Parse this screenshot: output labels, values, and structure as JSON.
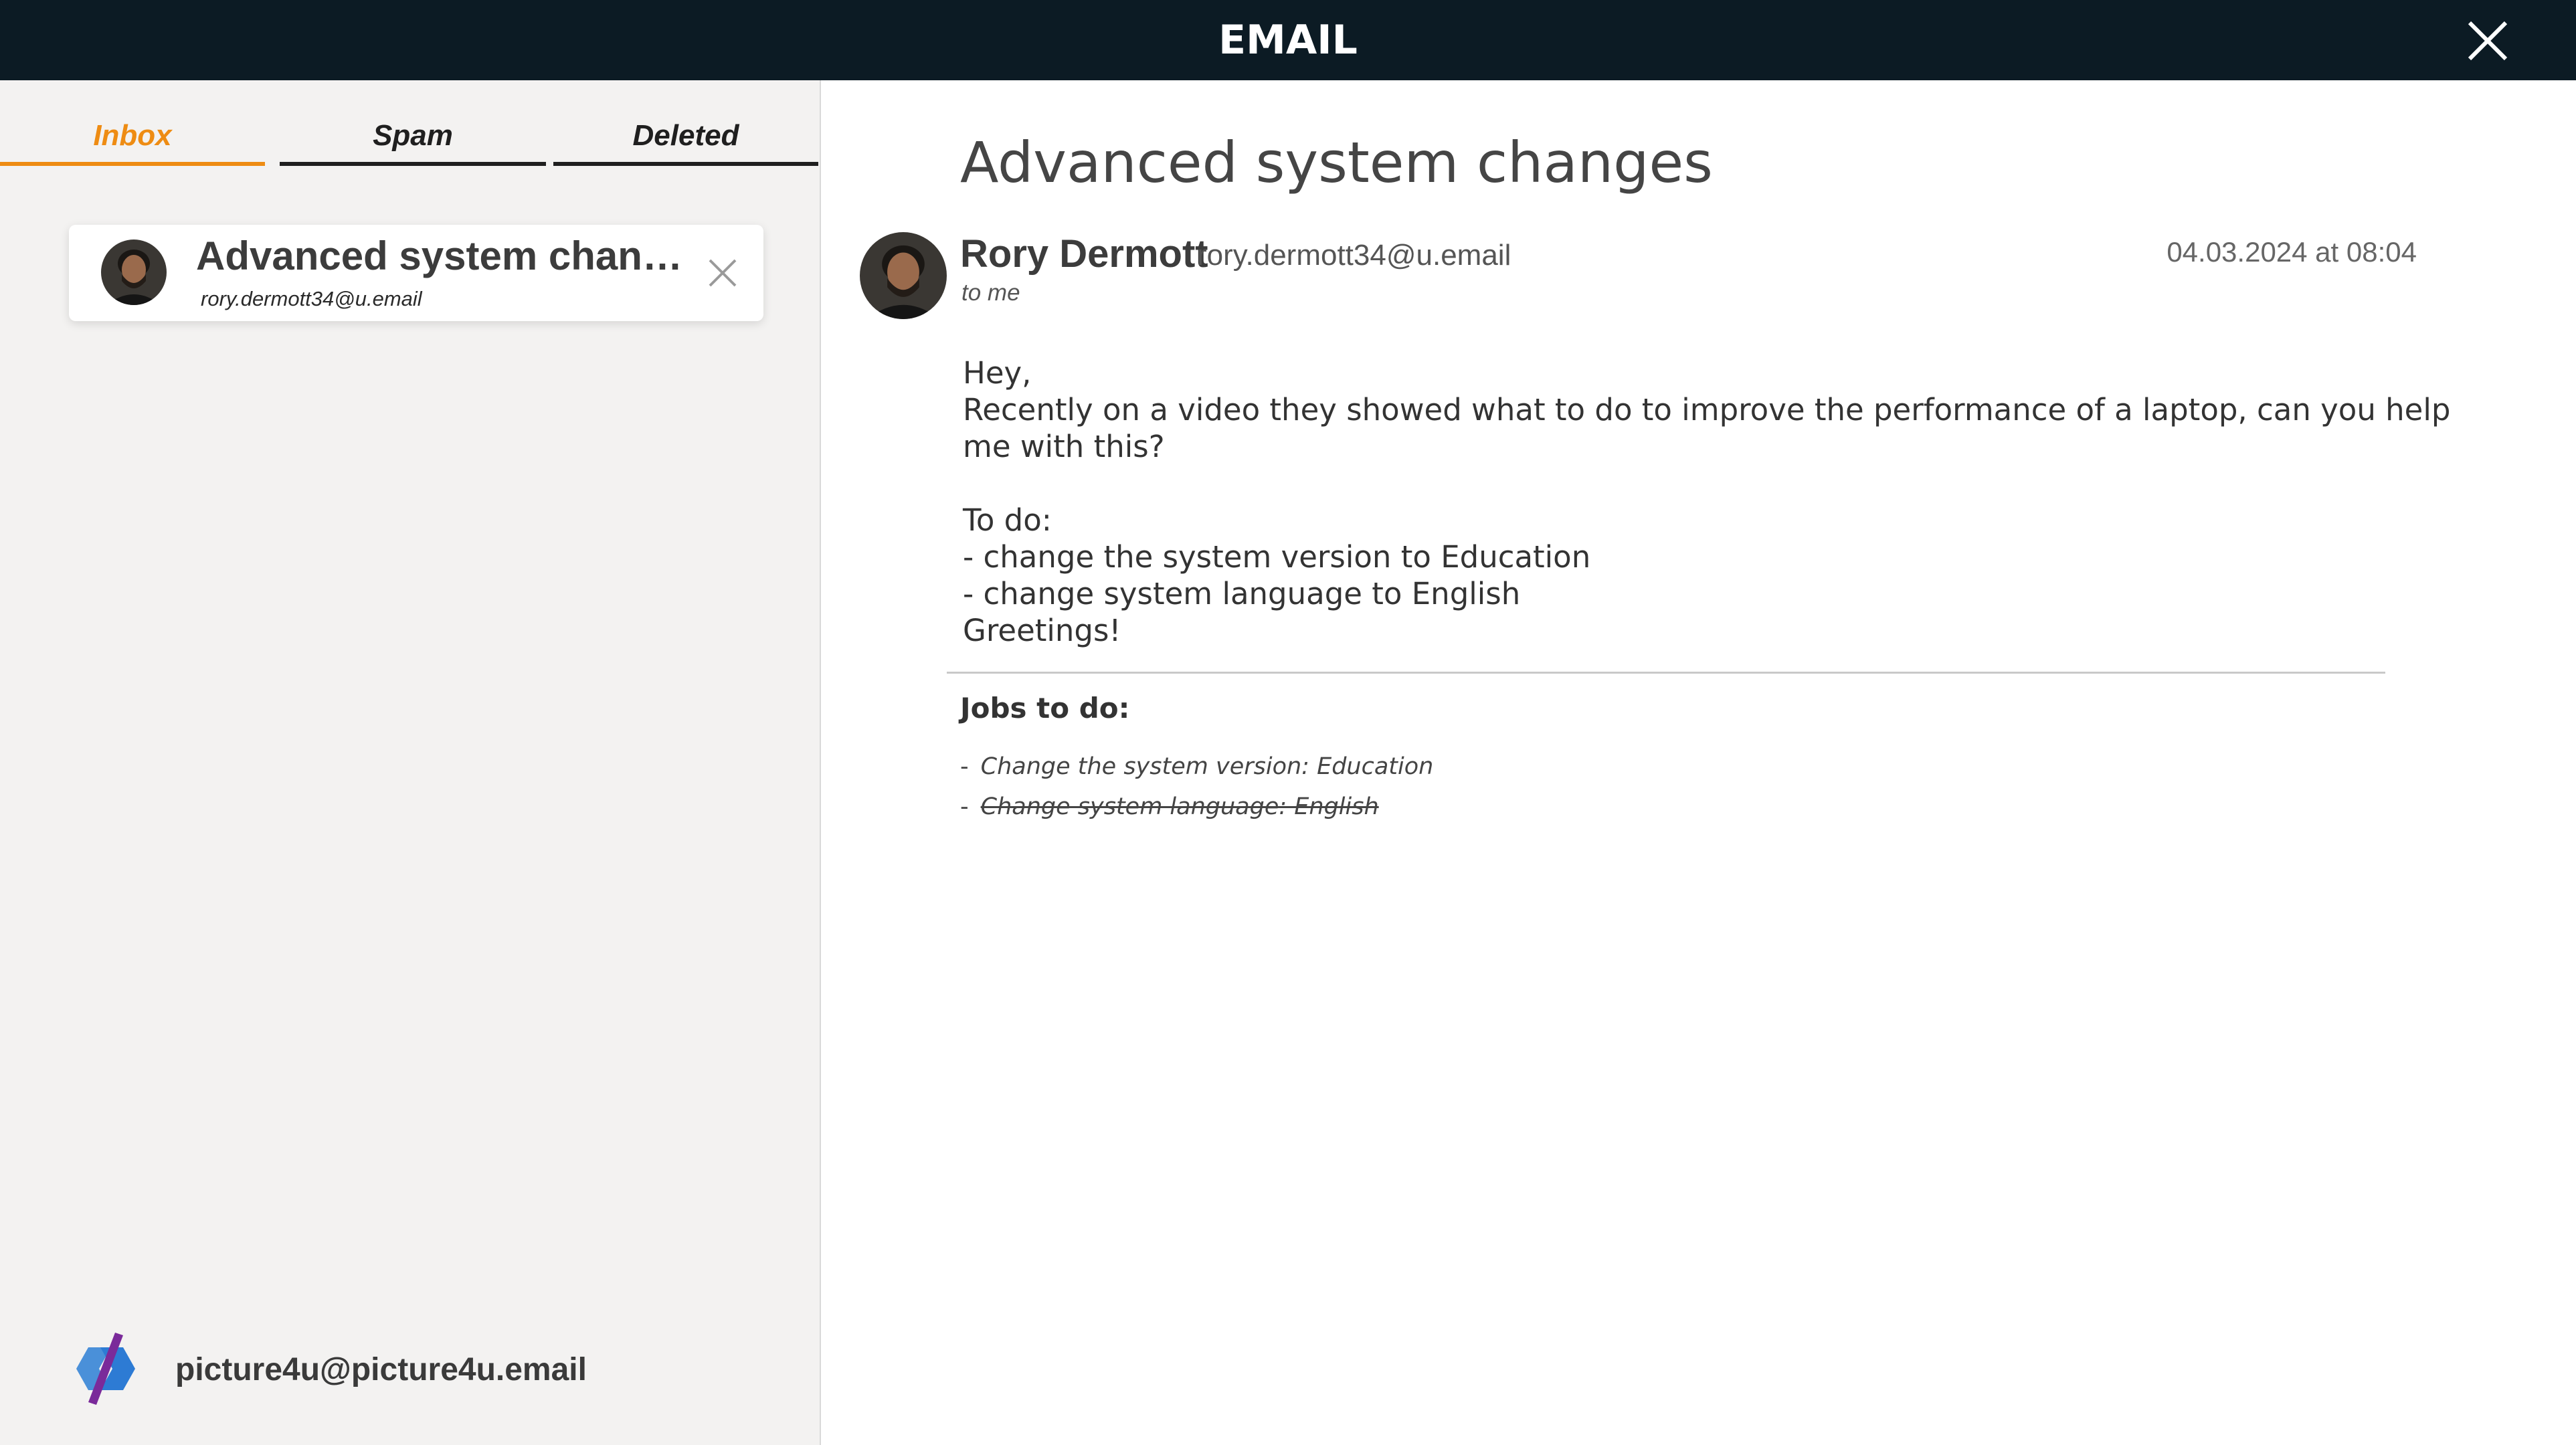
{
  "header": {
    "title": "EMAIL",
    "close_icon": "close-icon"
  },
  "tabs": [
    {
      "label": "Inbox",
      "active": true
    },
    {
      "label": "Spam",
      "active": false
    },
    {
      "label": "Deleted",
      "active": false
    }
  ],
  "inbox": {
    "items": [
      {
        "subject": "Advanced system changes",
        "from": "rory.dermott34@u.email"
      }
    ]
  },
  "account": {
    "email": "picture4u@picture4u.email",
    "logo_icon": "picture4u-logo"
  },
  "email": {
    "subject": "Advanced system changes",
    "sender_name": "Rory Dermott",
    "sender_email": "rory.dermott34@u.email",
    "recipient": "to me",
    "date": "04.03.2024 at 08:04",
    "body": [
      "Hey,",
      "Recently on a video they showed what to do to improve the performance of a laptop, can you help me with this?",
      "",
      "To do:",
      "- change the system version to Education",
      "- change system language to English",
      "Greetings!"
    ]
  },
  "jobs": {
    "title": "Jobs to do:",
    "items": [
      {
        "dash": "-",
        "text": "Change the system version: Education",
        "done": false
      },
      {
        "dash": "-",
        "text": "Change system language: English",
        "done": true
      }
    ]
  },
  "colors": {
    "header_bg": "#0c1b24",
    "accent": "#ee8c13",
    "sidebar_bg": "#f3f2f1"
  }
}
